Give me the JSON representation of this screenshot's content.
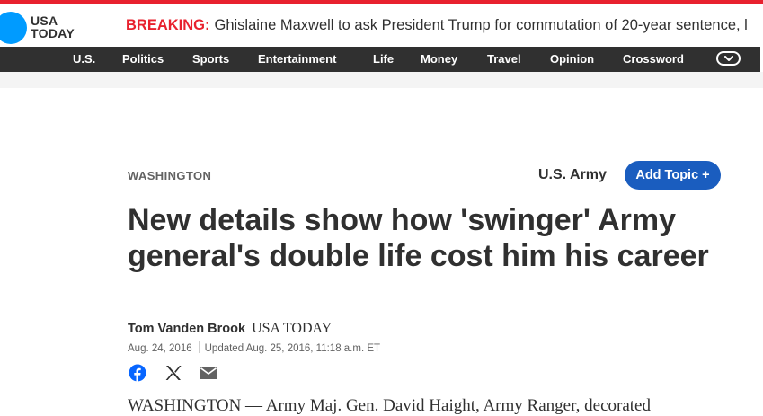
{
  "masthead": {
    "logo_line1": "USA",
    "logo_line2": "TODAY",
    "breaking_label": "BREAKING:",
    "breaking_text": "Ghislaine Maxwell to ask President Trump for commutation of 20-year sentence, l"
  },
  "nav": {
    "items": [
      "U.S.",
      "Politics",
      "Sports",
      "Entertainment",
      "Life",
      "Money",
      "Travel",
      "Opinion",
      "Crossword"
    ],
    "more_icon": "chevron-down-icon"
  },
  "article": {
    "section": "WASHINGTON",
    "topic": "U.S. Army",
    "add_topic_label": "Add Topic +",
    "headline": "New details show how 'swinger' Army general's double life cost him his career",
    "author": "Tom Vanden Brook",
    "publisher": "USA TODAY",
    "published": "Aug. 24, 2016",
    "updated": "Updated Aug. 25, 2016, 11:18 a.m. ET",
    "share_icons": [
      "facebook-icon",
      "x-icon",
      "email-icon"
    ],
    "body_start": "WASHINGTON — Army Maj. Gen. David Haight, Army Ranger, decorated"
  },
  "colors": {
    "brand_blue": "#009bff",
    "breaking_red": "#e8212e",
    "nav_bg": "#303030",
    "button_blue": "#1a5dbf"
  }
}
